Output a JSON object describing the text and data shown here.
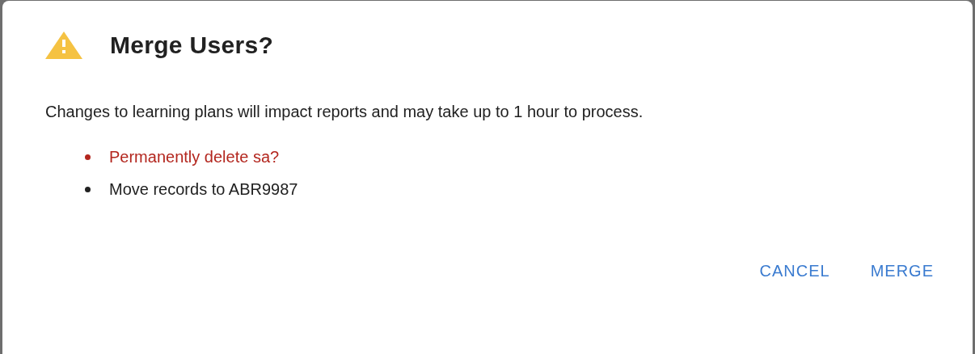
{
  "dialog": {
    "title": "Merge Users?",
    "message": "Changes to learning plans will impact reports and may take up to 1 hour to process.",
    "items": [
      {
        "text": "Permanently delete sa?",
        "color": "#b3261e"
      },
      {
        "text": "Move records to ABR9987",
        "color": "#212121"
      }
    ],
    "buttons": [
      "CANCEL",
      "MERGE"
    ]
  }
}
